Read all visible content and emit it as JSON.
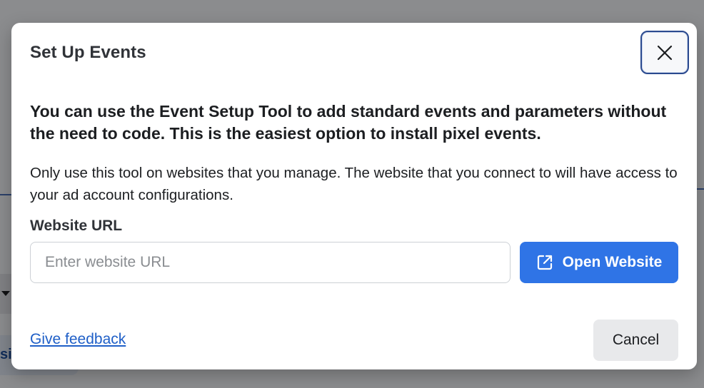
{
  "background": {
    "partial_tab_text": "si"
  },
  "dialog": {
    "title": "Set Up Events",
    "close_icon": "close-icon",
    "headline": "You can use the Event Setup Tool to add standard events and parameters without the need to code. This is the easiest option to install pixel events.",
    "description": "Only use this tool on websites that you manage. The website that you connect to will have access to your ad account configurations.",
    "field_label": "Website URL",
    "url_input": {
      "value": "",
      "placeholder": "Enter website URL"
    },
    "open_button": {
      "label": "Open Website",
      "icon": "external-link-icon"
    },
    "feedback_link": "Give feedback",
    "cancel_label": "Cancel"
  },
  "colors": {
    "primary": "#2f74e6",
    "link": "#1f5fc7",
    "overlay": "rgba(0,0,0,0.42)"
  }
}
